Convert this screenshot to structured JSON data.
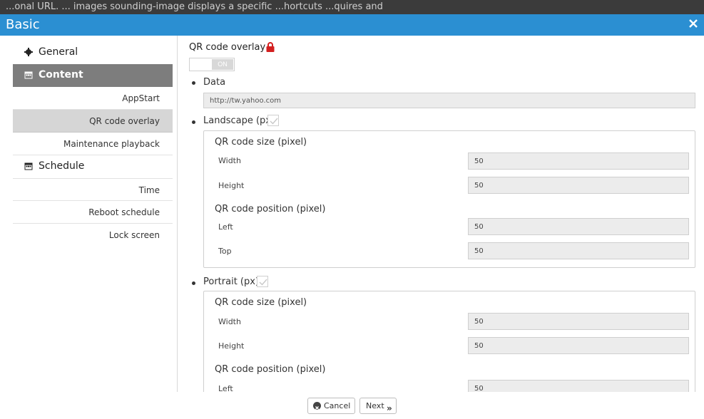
{
  "header_strip": {
    "text": "...onal URL. ... images sounding-image displays a specific  ...hortcuts ...quires and"
  },
  "window": {
    "title": "Basic",
    "close_icon": "close-icon",
    "accent": "#2b8fd2"
  },
  "sidebar": {
    "sections": [
      {
        "label": "General",
        "icon": "gear-icon"
      },
      {
        "label": "Content",
        "icon": "calendar-icon",
        "items": [
          "AppStart",
          "QR code overlay",
          "Maintenance playback"
        ]
      },
      {
        "label": "Schedule",
        "icon": "calendar-icon",
        "items": [
          "Time",
          "Reboot schedule",
          "Lock screen"
        ]
      }
    ]
  },
  "main": {
    "title": "QR code overlay",
    "toggle_label": "ON",
    "data": {
      "label": "Data",
      "value": "http://tw.yahoo.com"
    },
    "landscape": {
      "label": "Landscape (px)",
      "size_label": "QR code size (pixel)",
      "width_label": "Width",
      "width_value": "50",
      "height_label": "Height",
      "height_value": "50",
      "position_label": "QR code position (pixel)",
      "left_label": "Left",
      "left_value": "50",
      "top_label": "Top",
      "top_value": "50"
    },
    "portrait": {
      "label": "Portrait (px)",
      "size_label": "QR code size (pixel)",
      "width_label": "Width",
      "width_value": "50",
      "height_label": "Height",
      "height_value": "50",
      "position_label": "QR code position (pixel)",
      "left_label": "Left",
      "left_value": "50"
    }
  },
  "footer": {
    "cancel_label": "Cancel",
    "next_label": "Next",
    "next_icon": "»"
  }
}
